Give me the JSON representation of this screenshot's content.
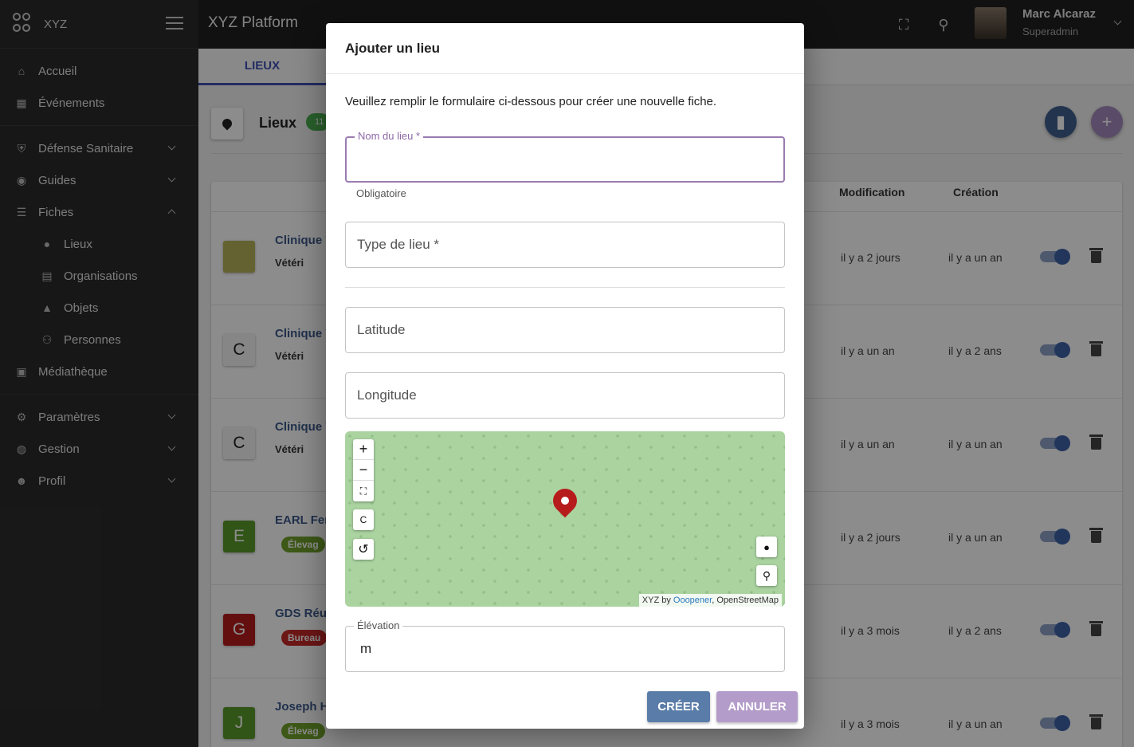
{
  "brand": {
    "name": "XYZ"
  },
  "sidebar": {
    "groups": [
      [
        {
          "label": "Accueil",
          "icon": "home-icon"
        },
        {
          "label": "Événements",
          "icon": "calendar-icon"
        }
      ],
      [
        {
          "label": "Défense Sanitaire",
          "icon": "shield-icon"
        },
        {
          "label": "Guides",
          "icon": "compass-icon"
        },
        {
          "label": "Fiches",
          "icon": "list-icon"
        }
      ],
      [
        {
          "label": "Paramètres",
          "icon": "gear-icon"
        },
        {
          "label": "Gestion",
          "icon": "palette-icon"
        },
        {
          "label": "Profil",
          "icon": "account-icon"
        }
      ]
    ],
    "fiches_sub": [
      {
        "label": "Lieux",
        "icon": "pin-icon"
      },
      {
        "label": "Organisations",
        "icon": "building-icon"
      },
      {
        "label": "Objets",
        "icon": "shapes-icon"
      },
      {
        "label": "Personnes",
        "icon": "people-icon"
      }
    ],
    "media": {
      "label": "Médiathèque",
      "icon": "image-icon"
    }
  },
  "topbar": {
    "title": "XYZ Platform",
    "user_name": "Marc Alcaraz",
    "user_role": "Superadmin"
  },
  "main": {
    "tab": "LIEUX",
    "section_title": "Lieux",
    "count": "11",
    "columns": {
      "modification": "Modification",
      "creation": "Création"
    },
    "rows": [
      {
        "initial": "",
        "color": "#b8b35a",
        "name": "Clinique V",
        "sub": "Vétéri",
        "chip": "",
        "chip_color": "",
        "mod": "il y a 2 jours",
        "cre": "il y a un an"
      },
      {
        "initial": "C",
        "color": "#f5f5f5",
        "name": "Clinique V",
        "sub": "Vétéri",
        "chip": "",
        "chip_color": "",
        "mod": "il y a un an",
        "cre": "il y a 2 ans"
      },
      {
        "initial": "C",
        "color": "#f5f5f5",
        "name": "Clinique V",
        "sub": "Vétéri",
        "chip": "",
        "chip_color": "",
        "mod": "il y a un an",
        "cre": "il y a un an"
      },
      {
        "initial": "E",
        "color": "#5a9a2a",
        "name": "EARL Fer",
        "sub": "",
        "chip": "Élevag",
        "chip_color": "#6fa12a",
        "mod": "il y a 2 jours",
        "cre": "il y a un an"
      },
      {
        "initial": "G",
        "color": "#b71c1c",
        "name": "GDS Réun",
        "sub": "",
        "chip": "Bureau",
        "chip_color": "#c62828",
        "mod": "il y a 3 mois",
        "cre": "il y a 2 ans"
      },
      {
        "initial": "J",
        "color": "#5a9a2a",
        "name": "Joseph H",
        "sub": "",
        "chip": "Élevag",
        "chip_color": "#6fa12a",
        "mod": "il y a 3 mois",
        "cre": "il y a un an"
      }
    ]
  },
  "modal": {
    "title": "Ajouter un lieu",
    "intro": "Veuillez remplir le formulaire ci-dessous pour créer une nouvelle fiche.",
    "name_label": "Nom du lieu *",
    "name_value": "",
    "name_helper": "Obligatoire",
    "type_label": "Type de lieu *",
    "latitude_label": "Latitude",
    "longitude_label": "Longitude",
    "elevation_label": "Élévation",
    "elevation_unit": "m",
    "map": {
      "zoom_in": "+",
      "zoom_out": "−",
      "c_button": "C",
      "attribution_prefix": "XYZ by ",
      "attribution_link": "Ooopener",
      "attribution_suffix": ", OpenStreetMap"
    },
    "create_label": "CRÉER",
    "cancel_label": "ANNULER",
    "colors": {
      "create": "#5a7ca8",
      "cancel": "#b39cc9",
      "focus": "#9a7bb0"
    }
  }
}
